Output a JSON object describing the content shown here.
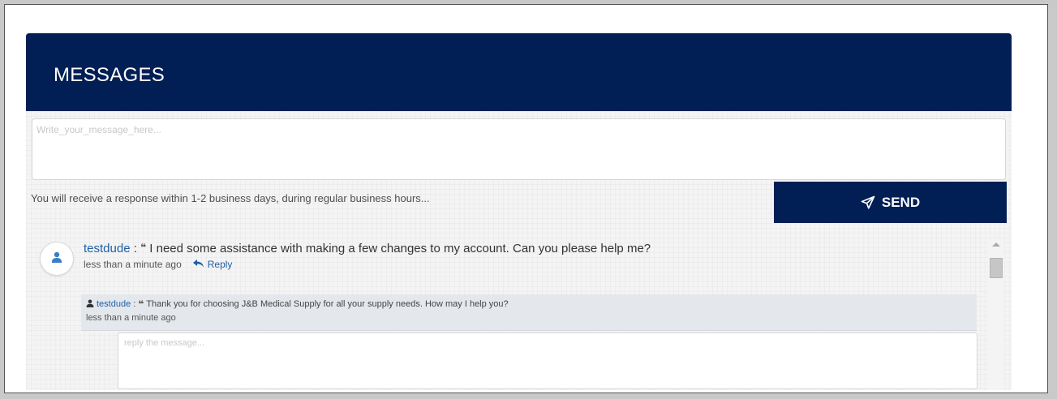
{
  "header": {
    "title": "MESSAGES"
  },
  "compose": {
    "placeholder": "Write_your_message_here..."
  },
  "notice": "You will receive a response within 1-2 business days, during regular business hours...",
  "send": {
    "label": "SEND",
    "icon": "paper-plane-icon"
  },
  "messages": [
    {
      "username": "testdude",
      "separator": " : ",
      "text": "I need some assistance with making a few changes to my account. Can you please help me?",
      "time": "less than a minute ago",
      "reply_label": "Reply",
      "replies": [
        {
          "username": "testdude",
          "separator": " : ",
          "text": "Thank you for choosing J&B Medical Supply for all your supply needs. How may I help you?",
          "time": "less than a minute ago"
        }
      ],
      "reply_placeholder": "reply the message..."
    }
  ],
  "colors": {
    "header_bg": "#011f54",
    "button_bg": "#011f54",
    "link": "#1f5fa6",
    "reply_bg": "#e4e8ec"
  }
}
